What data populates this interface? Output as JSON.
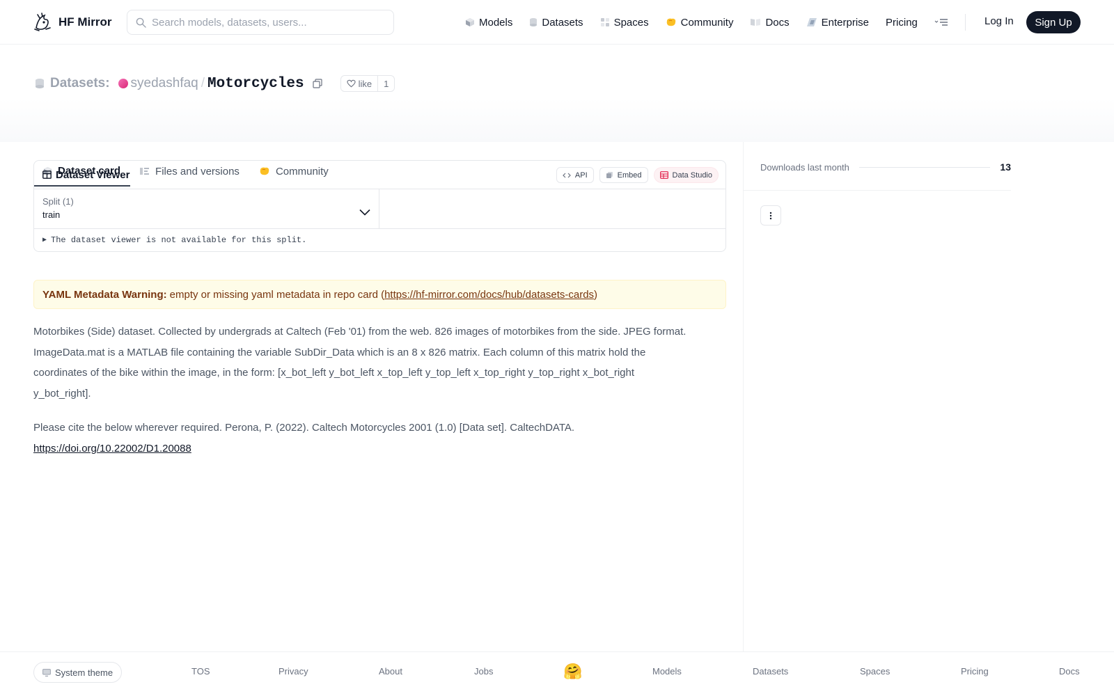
{
  "nav": {
    "brand": "HF Mirror",
    "search_placeholder": "Search models, datasets, users...",
    "links": [
      {
        "label": "Models",
        "icon": "models-icon"
      },
      {
        "label": "Datasets",
        "icon": "datasets-icon"
      },
      {
        "label": "Spaces",
        "icon": "spaces-icon"
      },
      {
        "label": "Community",
        "icon": "community-icon"
      },
      {
        "label": "Docs",
        "icon": "docs-icon"
      },
      {
        "label": "Enterprise",
        "icon": "enterprise-icon"
      },
      {
        "label": "Pricing"
      }
    ],
    "login": "Log In",
    "signup": "Sign Up"
  },
  "header": {
    "section": "Datasets:",
    "owner": "syedashfaq",
    "separator": "/",
    "repo": "Motorcycles",
    "like_label": "like",
    "like_count": "1"
  },
  "tabs": [
    {
      "label": "Dataset card",
      "active": true
    },
    {
      "label": "Files and versions"
    },
    {
      "label": "Community"
    }
  ],
  "viewer": {
    "title": "Dataset Viewer",
    "api_label": "API",
    "embed_label": "Embed",
    "studio_label": "Data Studio",
    "split_label": "Split (1)",
    "split_value": "train",
    "note": "The dataset viewer is not available for this split."
  },
  "warning": {
    "label": "YAML Metadata Warning:",
    "text": "empty or missing yaml metadata in repo card (",
    "link": "https://hf-mirror.com/docs/hub/datasets-cards",
    "close": ")"
  },
  "card": {
    "paragraph1": "Motorbikes (Side) dataset. Collected by undergrads at Caltech (Feb '01) from the web. 826 images of motorbikes from the side. JPEG format. ImageData.mat is a MATLAB file containing the variable SubDir_Data which is an 8 x 826 matrix. Each column of this matrix hold the coordinates of the bike within the image, in the form: [x_bot_left y_bot_left x_top_left y_top_left x_top_right y_top_right x_bot_right y_bot_right].",
    "paragraph2": "Please cite the below wherever required. Perona, P. (2022). Caltech Motorcycles 2001 (1.0) [Data set]. CaltechDATA.",
    "doi_link": "https://doi.org/10.22002/D1.20088"
  },
  "sidebar": {
    "downloads_label": "Downloads last month",
    "downloads_value": "13"
  },
  "footer": {
    "theme": "System theme",
    "links": [
      "TOS",
      "Privacy",
      "About",
      "Jobs",
      "Models",
      "Datasets",
      "Spaces",
      "Pricing",
      "Docs"
    ],
    "emoji": "🤗"
  }
}
